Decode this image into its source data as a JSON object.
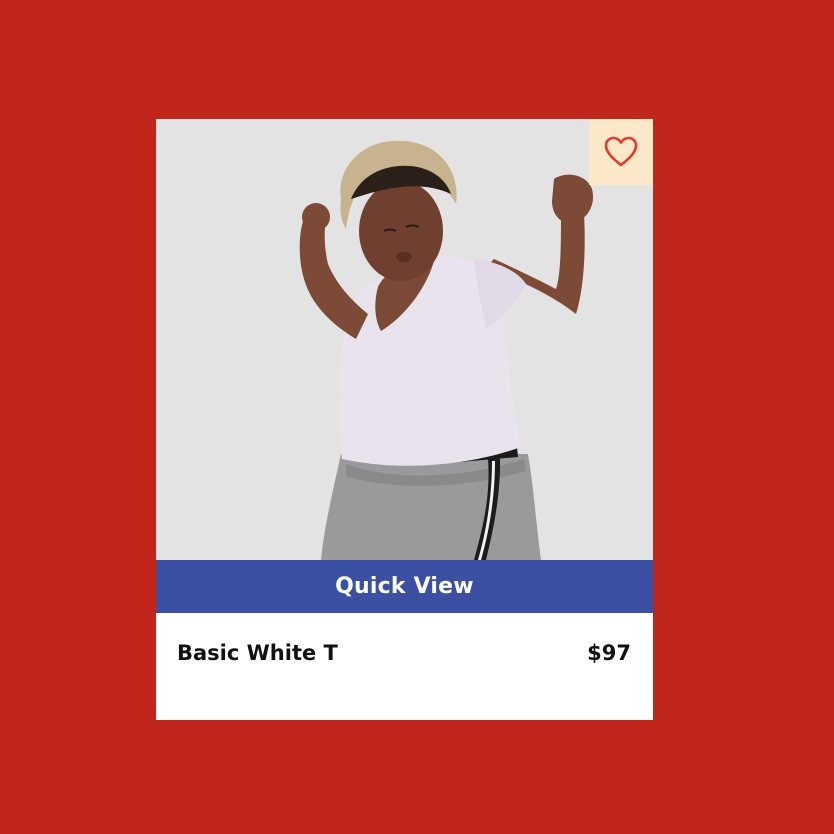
{
  "theme": {
    "page_background": "#c0261b",
    "card_background": "#ffffff",
    "photo_background": "#e4e3e4",
    "accent_blue": "#3b4fa3",
    "favorite_bg": "#fde7c9",
    "favorite_icon_color": "#e53b2c",
    "text_color": "#111111"
  },
  "product": {
    "image": {
      "description_icon": "product-photo-model",
      "alt": "Basic White T"
    },
    "favorite": {
      "icon": "heart-icon"
    },
    "quick_view_label": "Quick View",
    "name": "Basic White T",
    "price": "$97"
  }
}
